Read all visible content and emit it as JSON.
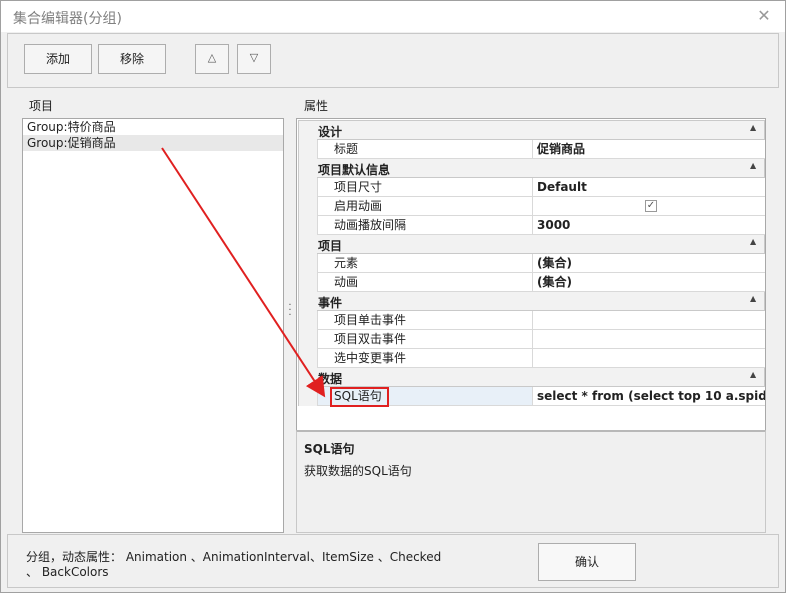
{
  "window": {
    "title": "集合编辑器(分组)",
    "close_glyph": "✕"
  },
  "toolbar": {
    "add_label": "添加",
    "remove_label": "移除",
    "up_glyph": "△",
    "down_glyph": "▽"
  },
  "items_panel": {
    "label": "项目",
    "items": [
      {
        "text": "Group:特价商品",
        "selected": false
      },
      {
        "text": "Group:促销商品",
        "selected": true
      }
    ]
  },
  "properties_panel": {
    "label": "属性",
    "categories": [
      {
        "name": "设计",
        "rows": [
          {
            "name": "标题",
            "value": "促销商品"
          }
        ]
      },
      {
        "name": "项目默认信息",
        "rows": [
          {
            "name": "项目尺寸",
            "value": "Default"
          },
          {
            "name": "启用动画",
            "value": "",
            "checked": true
          },
          {
            "name": "动画播放间隔",
            "value": "3000"
          }
        ]
      },
      {
        "name": "项目",
        "rows": [
          {
            "name": "元素",
            "value": "(集合)"
          },
          {
            "name": "动画",
            "value": "(集合)"
          }
        ]
      },
      {
        "name": "事件",
        "rows": [
          {
            "name": "项目单击事件",
            "value": ""
          },
          {
            "name": "项目双击事件",
            "value": ""
          },
          {
            "name": "选中变更事件",
            "value": ""
          }
        ]
      },
      {
        "name": "数据",
        "rows": [
          {
            "name": "SQL语句",
            "value": "select * from (select top 10 a.spid",
            "selected": true
          }
        ]
      }
    ],
    "collapse_glyph": "▲",
    "ellipsis_glyph": "···"
  },
  "description": {
    "title": "SQL语句",
    "text": "获取数据的SQL语句"
  },
  "footer": {
    "text": "分组，动态属性：  Animation 、AnimationInterval、ItemSize 、Checked 、 BackColors",
    "ok_label": "确认"
  },
  "colors": {
    "annotation": "#e02020",
    "background": "#f0f0f0"
  },
  "icons": {
    "close": "close-icon",
    "up": "move-up-icon",
    "down": "move-down-icon",
    "checkbox": "checkbox-icon",
    "ellipsis": "ellipsis-icon"
  }
}
